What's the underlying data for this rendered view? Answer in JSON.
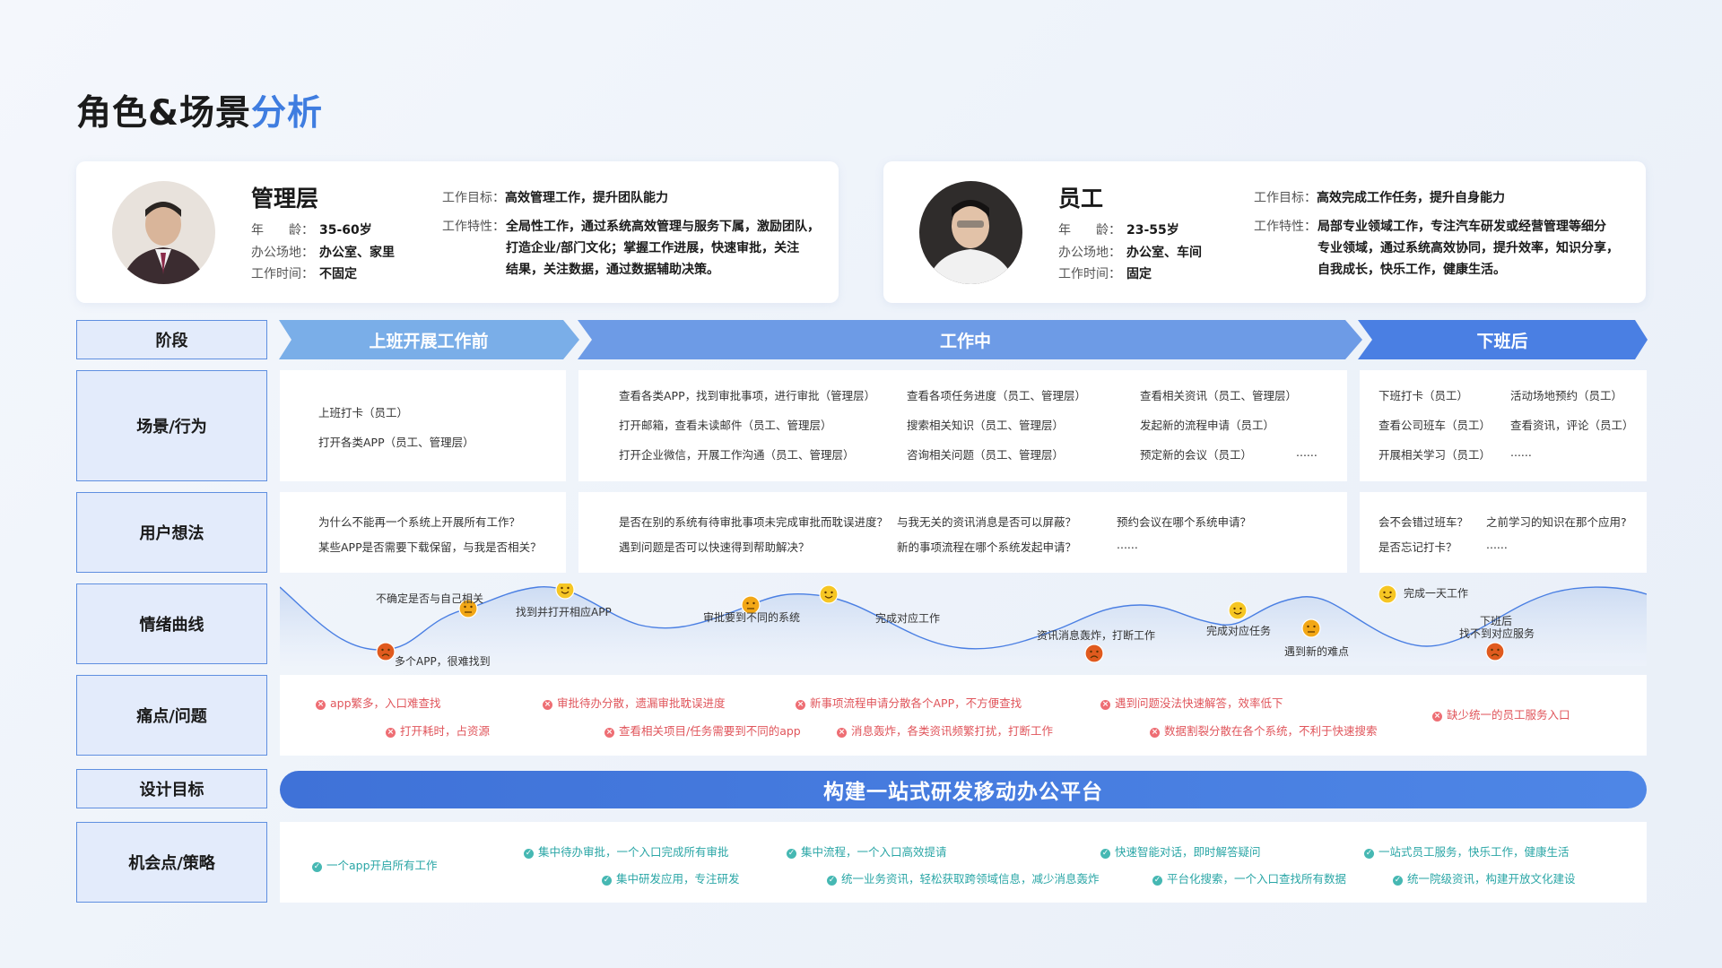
{
  "title": {
    "main": "角色&场景",
    "highlight": "分析"
  },
  "personas": [
    {
      "name": "管理层",
      "age_label": "年　　龄：",
      "age": "35-60岁",
      "place_label": "办公场地：",
      "place": "办公室、家里",
      "time_label": "工作时间：",
      "time": "不固定",
      "goal_label": "工作目标：",
      "goal": "高效管理工作，提升团队能力",
      "trait_label": "工作特性：",
      "trait_lines": [
        "全局性工作，通过系统高效管理与服务下属，激励团队，",
        "打造企业/部门文化；掌握工作进展，快速审批，关注",
        "结果，关注数据，通过数据辅助决策。"
      ]
    },
    {
      "name": "员工",
      "age_label": "年　　龄：",
      "age": "23-55岁",
      "place_label": "办公场地：",
      "place": "办公室、车间",
      "time_label": "工作时间：",
      "time": "固定",
      "goal_label": "工作目标：",
      "goal": "高效完成工作任务，提升自身能力",
      "trait_label": "工作特性：",
      "trait_lines": [
        "局部专业领域工作，专注汽车研发或经营管理等细分",
        "专业领域，通过系统高效协同，提升效率，知识分享，",
        "自我成长，快乐工作，健康生活。"
      ]
    }
  ],
  "rows": {
    "stage": "阶段",
    "scene": "场景/行为",
    "thought": "用户想法",
    "emotion": "情绪曲线",
    "pain": "痛点/问题",
    "goal": "设计目标",
    "opportunity": "机会点/策略"
  },
  "stages": [
    "上班开展工作前",
    "工作中",
    "下班后"
  ],
  "scenes": {
    "before": [
      "上班打卡（员工）",
      "打开各类APP（员工、管理层）"
    ],
    "during_col1": [
      "查看各类APP，找到审批事项，进行审批（管理层）",
      "打开邮箱，查看未读邮件（员工、管理层）",
      "打开企业微信，开展工作沟通（员工、管理层）"
    ],
    "during_col2": [
      "查看各项任务进度（员工、管理层）",
      "搜索相关知识（员工、管理层）",
      "咨询相关问题（员工、管理层）"
    ],
    "during_col3": [
      "查看相关资讯（员工、管理层）",
      "发起新的流程申请（员工）",
      "预定新的会议（员工）"
    ],
    "during_more": "......",
    "after_col1": [
      "下班打卡（员工）",
      "查看公司班车（员工）",
      "开展相关学习（员工）"
    ],
    "after_col2": [
      "活动场地预约（员工）",
      "查看资讯，评论（员工）",
      "......"
    ]
  },
  "thoughts": {
    "before": [
      "为什么不能再一个系统上开展所有工作？",
      "某些APP是否需要下载保留，与我是否相关？"
    ],
    "during_col1": [
      "是否在别的系统有待审批事项未完成审批而耽误进度？",
      "遇到问题是否可以快速得到帮助解决？"
    ],
    "during_col2": [
      "与我无关的资讯消息是否可以屏蔽？",
      "新的事项流程在哪个系统发起申请？"
    ],
    "during_col3": [
      "预约会议在哪个系统申请？",
      "......"
    ],
    "after_col1": [
      "会不会错过班车？",
      "是否忘记打卡？"
    ],
    "after_col2": [
      "之前学习的知识在那个应用?",
      "......"
    ]
  },
  "emotion_points": [
    {
      "label": "多个APP，很难找到",
      "mood": "sad"
    },
    {
      "label": "不确定是否与自己相关",
      "mood": "neutral"
    },
    {
      "label": "找到并打开相应APP",
      "mood": "happy"
    },
    {
      "label": "审批要到不同的系统",
      "mood": "neutral"
    },
    {
      "label": "完成对应工作",
      "mood": "happy"
    },
    {
      "label": "资讯消息轰炸，打断工作",
      "mood": "sad"
    },
    {
      "label": "完成对应任务",
      "mood": "happy"
    },
    {
      "label": "遇到新的难点",
      "mood": "neutral"
    },
    {
      "label": "完成一天工作",
      "mood": "happy"
    },
    {
      "label": "下班后",
      "mood": "sad"
    },
    {
      "label": "找不到对应服务",
      "mood": "sad"
    }
  ],
  "pains": [
    "app繁多，入口难查找",
    "打开耗时，占资源",
    "审批待办分散，遗漏审批耽误进度",
    "查看相关项目/任务需要到不同的app",
    "新事项流程申请分散各个APP，不方便查找",
    "消息轰炸，各类资讯频繁打扰，打断工作",
    "遇到问题没法快速解答，效率低下",
    "数据割裂分散在各个系统，不利于快速搜索",
    "缺少统一的员工服务入口"
  ],
  "design_goal": "构建一站式研发移动办公平台",
  "opportunities": [
    "一个app开启所有工作",
    "集中待办审批，一个入口完成所有审批",
    "集中研发应用，专注研发",
    "集中流程，一个入口高效提请",
    "统一业务资讯，轻松获取跨领域信息，减少消息轰炸",
    "快速智能对话，即时解答疑问",
    "平台化搜索，一个入口查找所有数据",
    "一站式员工服务，快乐工作，健康生活",
    "统一院级资讯，构建开放文化建设"
  ],
  "colors": {
    "accent": "#3f7de0",
    "pain": "#e0555b",
    "opportunity": "#2aa6a6",
    "stage_light": "#7aaee8",
    "stage_mid": "#6d9be6",
    "stage_dark": "#4a7fe3"
  }
}
